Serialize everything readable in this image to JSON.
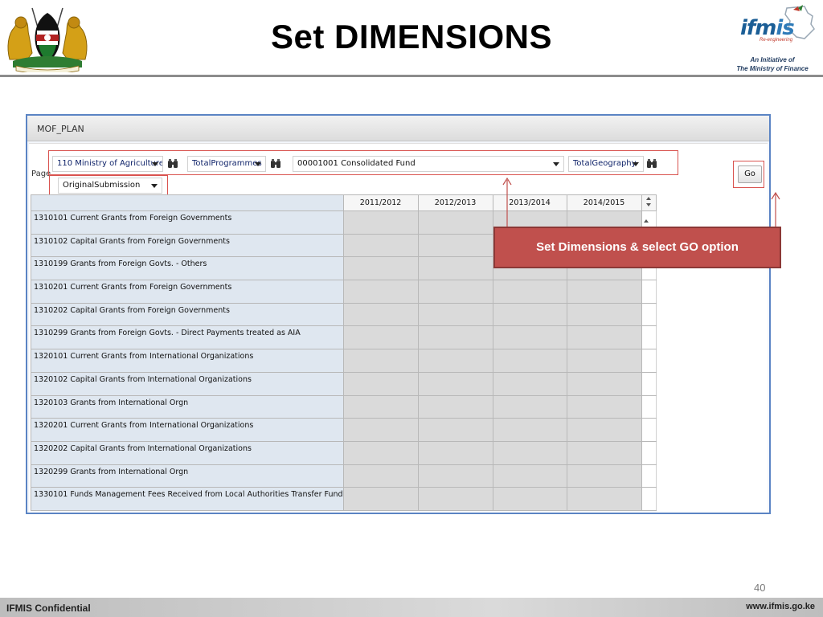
{
  "slide": {
    "title": "Set DIMENSIONS",
    "number": "40",
    "footer_left": "IFMIS Confidential",
    "footer_right": "www.ifmis.go.ke"
  },
  "logo": {
    "word_i": "ifm",
    "word_is": "is",
    "sub": "Re-engineering",
    "tagline_1": "An Initiative of",
    "tagline_2": "The Ministry of Finance"
  },
  "app": {
    "title": "MOF_PLAN",
    "page_label": "Page",
    "dimensions": {
      "ministry": "110 Ministry of Agriculture",
      "programmes": "TotalProgrammes",
      "fund": "00001001 Consolidated Fund",
      "geography": "TotalGeography",
      "submission": "OriginalSubmission"
    },
    "go_label": "Go"
  },
  "grid": {
    "columns": [
      "2011/2012",
      "2012/2013",
      "2013/2014",
      "2014/2015"
    ],
    "rows": [
      "1310101 Current Grants from Foreign Governments",
      "1310102 Capital Grants from Foreign Governments",
      "1310199 Grants from Foreign Govts. - Others",
      "1310201 Current Grants from Foreign Governments",
      "1310202 Capital Grants from Foreign Governments",
      "1310299 Grants from Foreign Govts. - Direct Payments treated as AIA",
      "1320101 Current Grants from International Organizations",
      "1320102 Capital Grants from International Organizations",
      "1320103 Grants from International Orgn",
      "1320201 Current Grants from International Organizations",
      "1320202 Capital Grants from International Organizations",
      "1320299 Grants from International Orgn",
      "1330101 Funds Management Fees Received from Local Authorities Transfer Fund"
    ]
  },
  "callout": {
    "text": "Set Dimensions & select GO option"
  },
  "colors": {
    "callout_bg": "#c0504d",
    "highlight_border": "#d9534f",
    "window_border": "#5b84c4",
    "row_label_bg": "#dfe7f0",
    "cell_bg": "#dadada"
  }
}
